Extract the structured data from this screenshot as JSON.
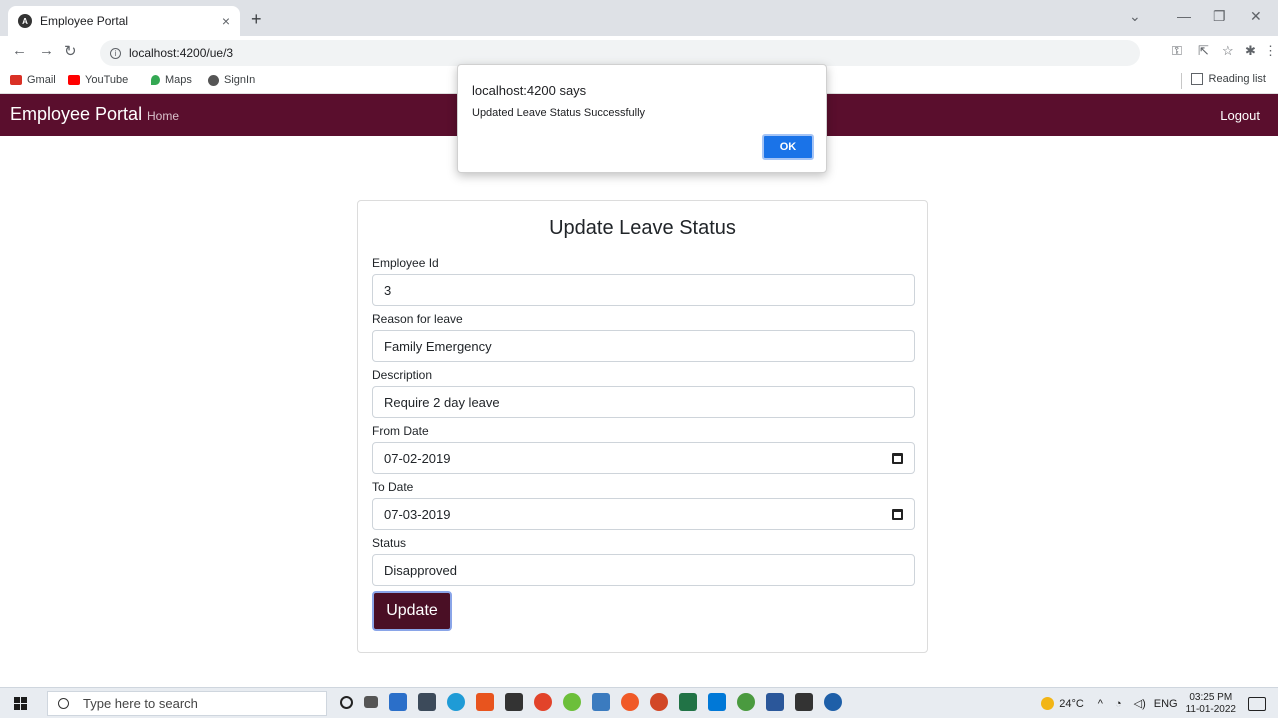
{
  "browser": {
    "tab_title": "Employee Portal",
    "tab_close": "×",
    "new_tab": "+",
    "url": "localhost:4200/ue/3",
    "bookmarks": [
      "Gmail",
      "YouTube",
      "Maps",
      "SignIn"
    ],
    "reading_list": "Reading list"
  },
  "navbar": {
    "brand": "Employee Portal",
    "home": "Home",
    "logout": "Logout"
  },
  "form": {
    "title": "Update Leave Status",
    "fields": [
      {
        "label": "Employee Id",
        "value": "3"
      },
      {
        "label": "Reason for leave",
        "value": "Family Emergency"
      },
      {
        "label": "Description",
        "value": "Require 2 day leave"
      },
      {
        "label": "From Date",
        "value": "07-02-2019"
      },
      {
        "label": "To Date",
        "value": "07-03-2019"
      },
      {
        "label": "Status",
        "value": "Disapproved"
      }
    ],
    "submit_label": "Update"
  },
  "alert": {
    "title": "localhost:4200 says",
    "message": "Updated Leave Status Successfully",
    "ok_label": "OK"
  },
  "taskbar": {
    "search_placeholder": "Type here to search",
    "weather": "24°C",
    "language": "ENG",
    "time": "03:25 PM",
    "date": "11-01-2022"
  },
  "colors": {
    "navbar_bg": "#5a0e2d",
    "button_bg": "#4a0f25",
    "dialog_ok": "#1a73e8"
  }
}
